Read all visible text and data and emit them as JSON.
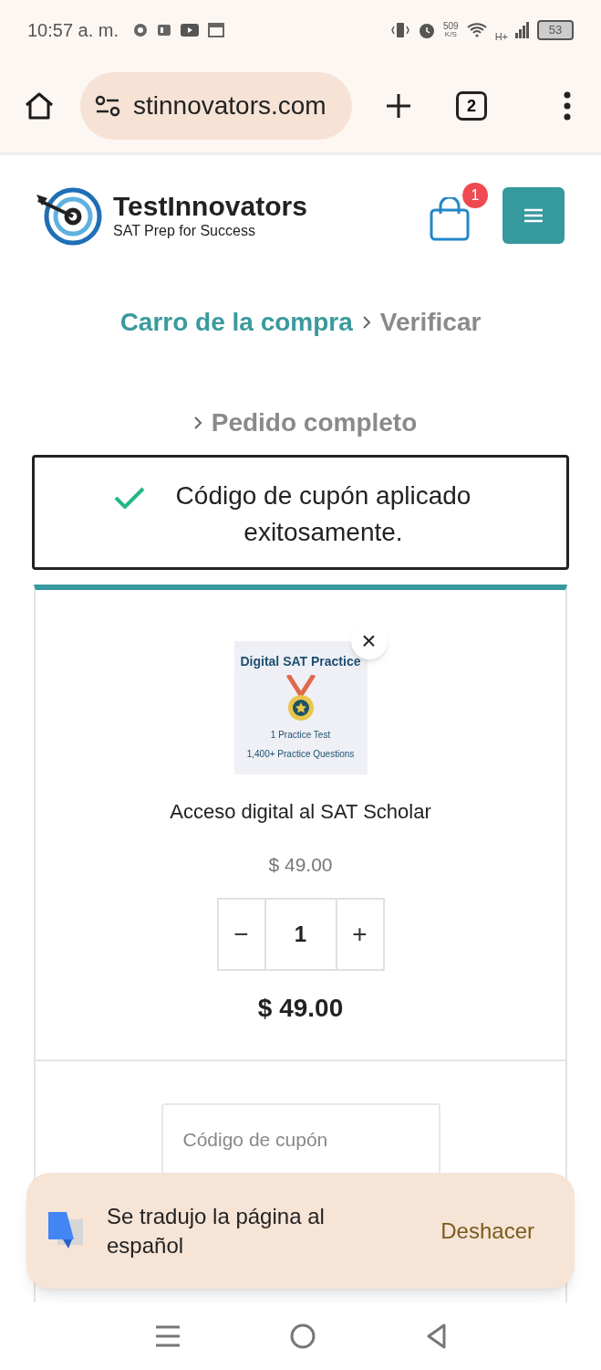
{
  "status_bar": {
    "time": "10:57 a. m.",
    "speed": "509",
    "speed_unit": "K/S",
    "network": "H+",
    "battery": "53"
  },
  "browser": {
    "url": "stinnovators.com",
    "tab_count": "2"
  },
  "header": {
    "brand": "TestInnovators",
    "tagline": "SAT Prep for Success",
    "cart_count": "1"
  },
  "steps": [
    {
      "label": "Carro de la compra",
      "selected": true
    },
    {
      "label": "Verificar",
      "selected": false
    },
    {
      "label": "Pedido completo",
      "selected": false
    }
  ],
  "notice": "Código de cupón aplicado exitosamente.",
  "item": {
    "image_title": "Digital SAT Practice",
    "image_line_1": "1 Practice Test",
    "image_line_2": "1,400+ Practice Questions",
    "name": "Acceso digital al SAT Scholar",
    "price": "$ 49.00",
    "minus": "−",
    "quantity": "1",
    "plus": "+",
    "subtotal": "$ 49.00",
    "remove": "×"
  },
  "coupon": {
    "placeholder": "Código de cupón"
  },
  "snackbar": {
    "message": "Se tradujo la página al español",
    "action": "Deshacer"
  }
}
